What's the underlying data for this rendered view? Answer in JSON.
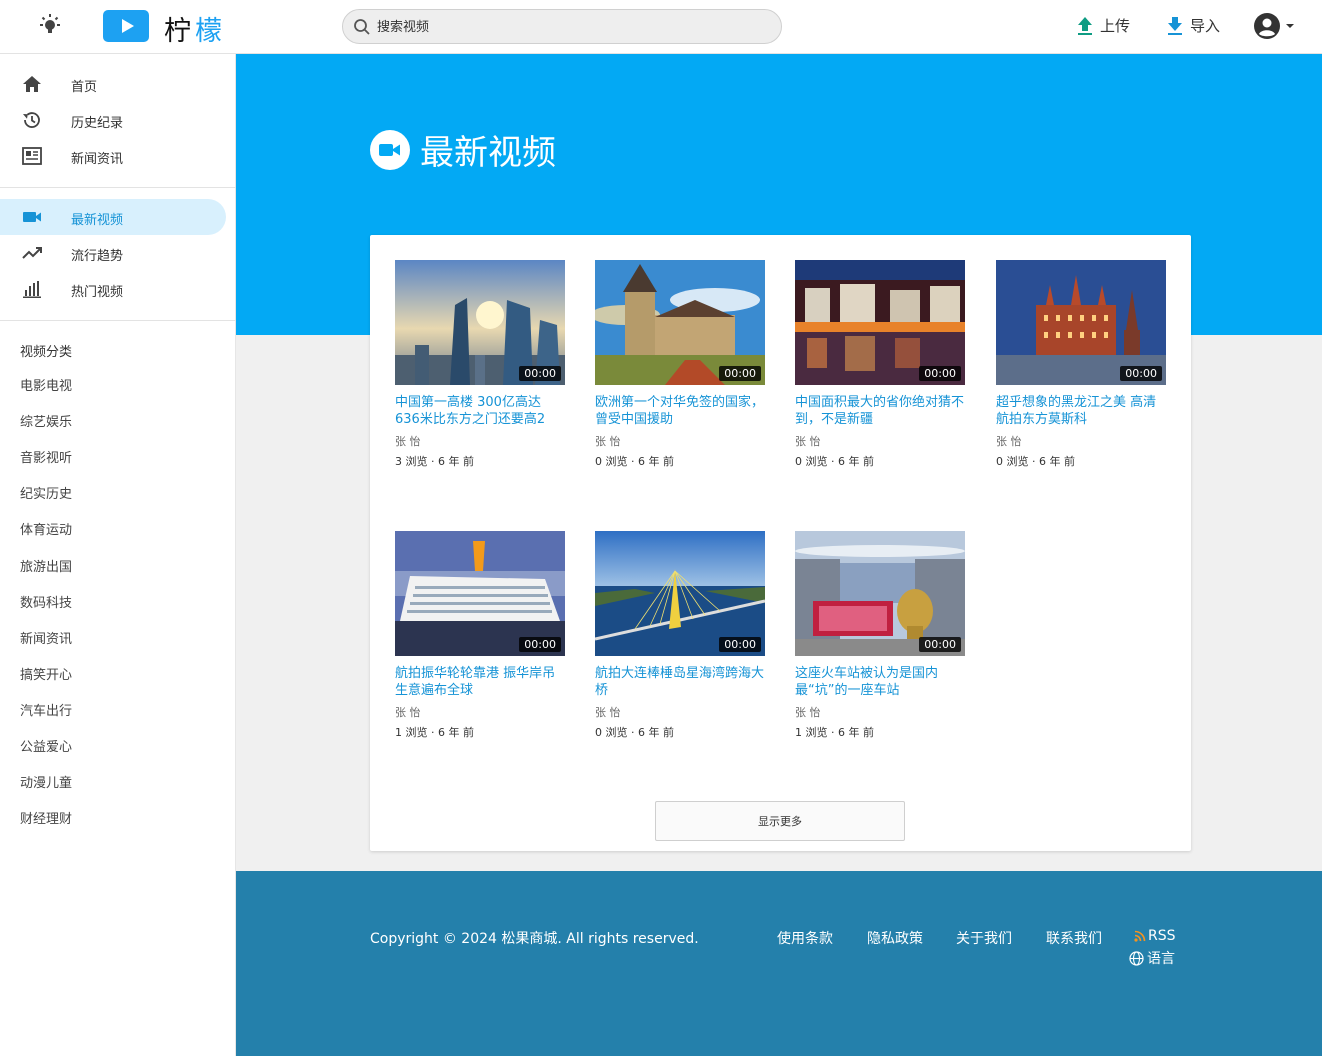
{
  "header": {
    "logo_text_1": "柠",
    "logo_text_2": "檬",
    "search_placeholder": "搜索视频",
    "upload_label": "上传",
    "import_label": "导入"
  },
  "sidebar": {
    "main_nav": [
      {
        "label": "首页",
        "icon": "home-icon"
      },
      {
        "label": "历史纪录",
        "icon": "history-icon"
      },
      {
        "label": "新闻资讯",
        "icon": "news-icon"
      }
    ],
    "video_nav": [
      {
        "label": "最新视频",
        "icon": "video-camera-icon",
        "active": true
      },
      {
        "label": "流行趋势",
        "icon": "trending-icon"
      },
      {
        "label": "热门视频",
        "icon": "bar-chart-icon"
      }
    ],
    "category_title": "视频分类",
    "categories": [
      "电影电视",
      "综艺娱乐",
      "音影视听",
      "纪实历史",
      "体育运动",
      "旅游出国",
      "数码科技",
      "新闻资讯",
      "搞笑开心",
      "汽车出行",
      "公益爱心",
      "动漫儿童",
      "财经理财"
    ]
  },
  "main": {
    "title": "最新视频",
    "videos": [
      {
        "title": "中国第一高楼 300亿高达636米比东方之门还要高2",
        "author": "张 怡",
        "meta": "3 浏览 · 6 年 前",
        "duration": "00:00"
      },
      {
        "title": "欧洲第一个对华免签的国家，曾受中国援助",
        "author": "张 怡",
        "meta": "0 浏览 · 6 年 前",
        "duration": "00:00"
      },
      {
        "title": "中国面积最大的省你绝对猜不到，不是新疆",
        "author": "张 怡",
        "meta": "0 浏览 · 6 年 前",
        "duration": "00:00"
      },
      {
        "title": "超乎想象的黑龙江之美 高清航拍东方莫斯科",
        "author": "张 怡",
        "meta": "0 浏览 · 6 年 前",
        "duration": "00:00"
      },
      {
        "title": "航拍振华轮轮靠港 振华岸吊生意遍布全球",
        "author": "张 怡",
        "meta": "1 浏览 · 6 年 前",
        "duration": "00:00"
      },
      {
        "title": "航拍大连棒棰岛星海湾跨海大桥",
        "author": "张 怡",
        "meta": "0 浏览 · 6 年 前",
        "duration": "00:00"
      },
      {
        "title": "这座火车站被认为是国内最“坑”的一座车站",
        "author": "张 怡",
        "meta": "1 浏览 · 6 年 前",
        "duration": "00:00"
      }
    ],
    "more_label": "显示更多"
  },
  "footer": {
    "copyright": "Copyright © 2024 松果商城. All rights reserved.",
    "links": [
      "使用条款",
      "隐私政策",
      "关于我们",
      "联系我们"
    ],
    "rss_label": "RSS",
    "language_label": "语言"
  },
  "colors": {
    "accent": "#1da1f2",
    "banner": "#03a9f4",
    "link": "#1693d6",
    "footer": "#2480ab"
  }
}
